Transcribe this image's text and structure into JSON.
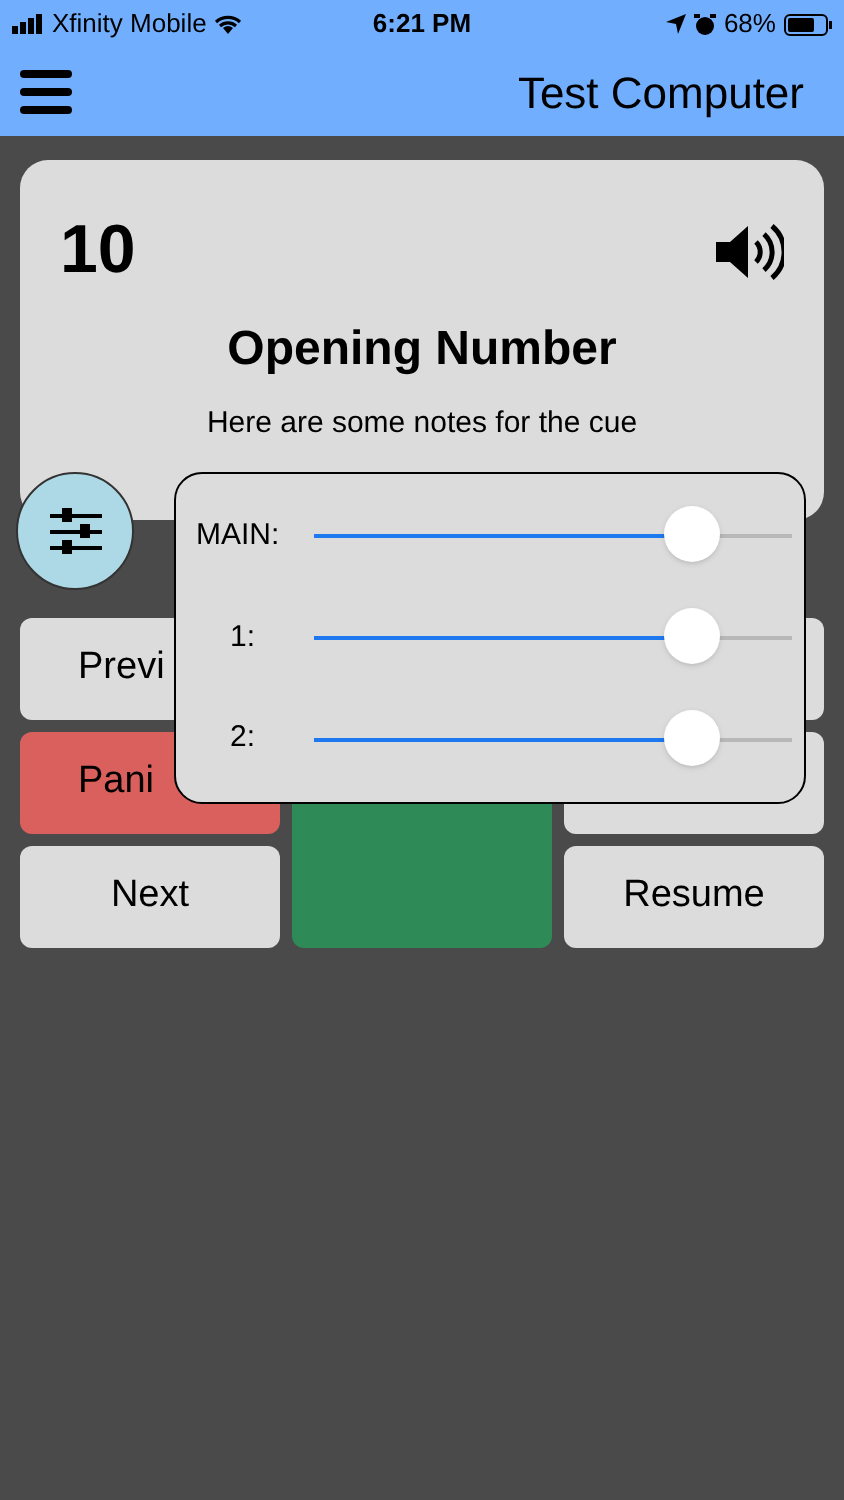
{
  "status_bar": {
    "carrier": "Xfinity Mobile",
    "time": "6:21 PM",
    "battery": "68%"
  },
  "header": {
    "title": "Test Computer"
  },
  "cue": {
    "number": "10",
    "title": "Opening Number",
    "notes": "Here are some notes for the cue"
  },
  "buttons": [
    {
      "label": "Previ",
      "kind": "gray"
    },
    {
      "kind": "gray"
    },
    {
      "label": "Pani",
      "kind": "red"
    },
    {
      "kind": "green"
    },
    {
      "kind": "gray"
    },
    {
      "label": "Next",
      "kind": "gray"
    },
    {
      "label": "Resume",
      "kind": "gray"
    }
  ],
  "volume_popup": {
    "sliders": [
      {
        "label": "MAIN:",
        "level": 0.79
      },
      {
        "label": "1:",
        "level": 0.79
      },
      {
        "label": "2:",
        "level": 0.79
      }
    ]
  }
}
